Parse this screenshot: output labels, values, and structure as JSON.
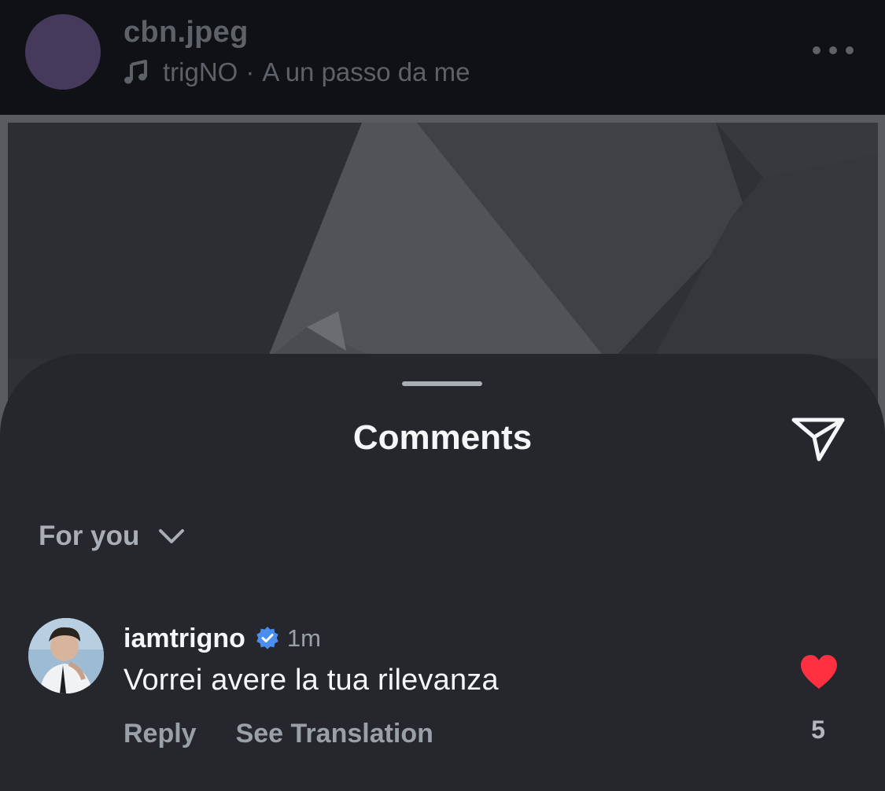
{
  "post": {
    "username": "cbn.jpeg",
    "audio": {
      "icon": "music-note-icon",
      "artist": "trigNO",
      "separator": "·",
      "track": "A un passo da me"
    },
    "more_icon": "more-horizontal-icon"
  },
  "comments_sheet": {
    "title": "Comments",
    "share_icon": "paper-plane-icon",
    "sort": {
      "label": "For you",
      "icon": "chevron-down-icon"
    },
    "comments": [
      {
        "username": "iamtrigno",
        "verified": true,
        "time": "1m",
        "text": "Vorrei avere la tua rilevanza",
        "reply_label": "Reply",
        "translation_label": "See Translation",
        "liked": true,
        "like_count": "5"
      }
    ]
  },
  "colors": {
    "sheet_background": "#25272d",
    "like_red": "#ff3040",
    "verified_blue": "#4a8ef0",
    "primary_text": "#f5f6f8",
    "secondary_text": "#9aa0a8"
  }
}
